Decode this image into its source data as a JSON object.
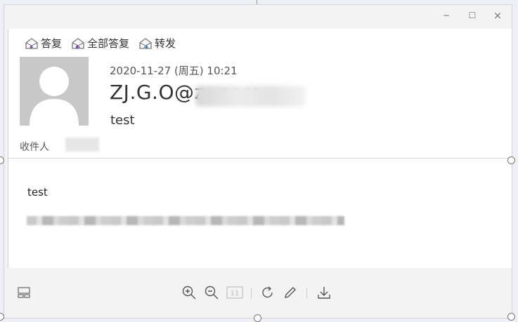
{
  "window": {
    "minimize": "−",
    "maximize": "☐",
    "close": "×"
  },
  "toolbar": {
    "reply": "答复",
    "reply_all": "全部答复",
    "forward": "转发"
  },
  "email": {
    "date": "2020-11-27 (周五) 10:21",
    "sender": "ZJ.G.O@z              .com",
    "subject": "test",
    "recipient_label": "收件人",
    "body_text": "test"
  },
  "bottom": {
    "page_number": "11"
  },
  "icons": [
    "reply-icon",
    "reply-all-icon",
    "forward-icon",
    "layout-icon",
    "zoom-in-icon",
    "zoom-out-icon",
    "page-icon",
    "rotate-icon",
    "edit-icon",
    "download-icon"
  ]
}
